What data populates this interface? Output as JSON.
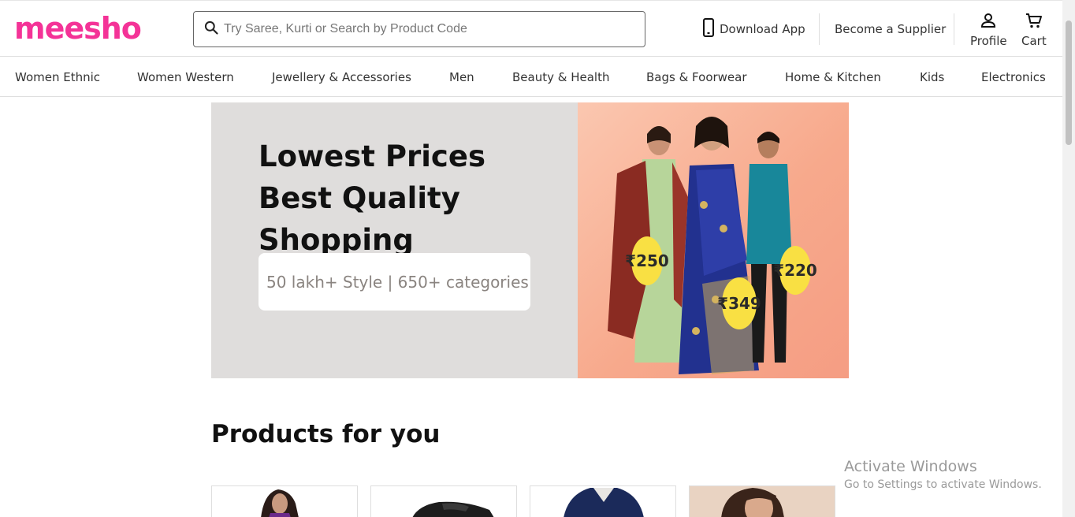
{
  "brand": {
    "logo_text": "meesho",
    "color": "#f43397"
  },
  "search": {
    "placeholder": "Try Saree, Kurti or Search by Product Code",
    "icon": "search-icon"
  },
  "header": {
    "download_app": "Download App",
    "become_supplier": "Become a Supplier",
    "profile": "Profile",
    "cart": "Cart"
  },
  "nav": {
    "items": [
      "Women Ethnic",
      "Women Western",
      "Jewellery & Accessories",
      "Men",
      "Beauty & Health",
      "Bags & Foorwear",
      "Home & Kitchen",
      "Kids",
      "Electronics"
    ]
  },
  "banner": {
    "title": "Lowest Prices Best Quality Shopping",
    "subtitle": "50 lakh+ Style | 650+ categories",
    "price_tags": [
      "₹250",
      "₹349",
      "₹220"
    ]
  },
  "products": {
    "title": "Products for you"
  },
  "watermark": {
    "line1": "Activate Windows",
    "line2": "Go to Settings to activate Windows."
  }
}
